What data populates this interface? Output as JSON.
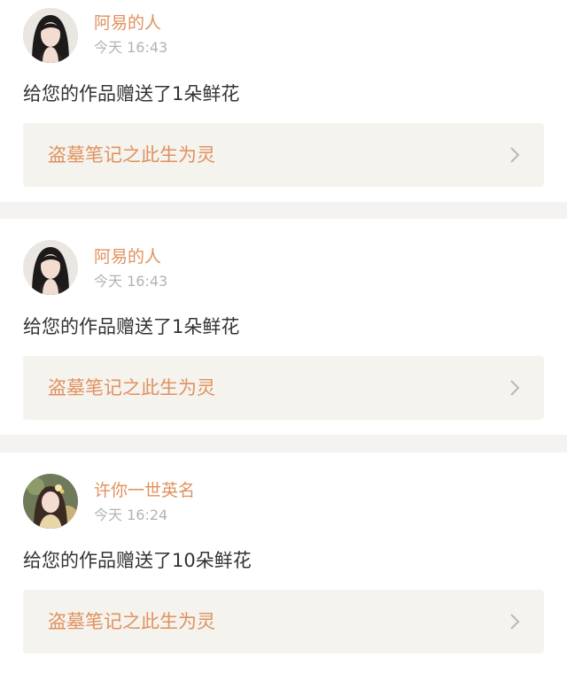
{
  "notifications": [
    {
      "user": "阿易的人",
      "time": "今天 16:43",
      "message": "给您的作品赠送了1朵鲜花",
      "work_title": "盗墓笔记之此生为灵",
      "avatar": "portrait-dark-hair"
    },
    {
      "user": "阿易的人",
      "time": "今天 16:43",
      "message": "给您的作品赠送了1朵鲜花",
      "work_title": "盗墓笔记之此生为灵",
      "avatar": "portrait-dark-hair"
    },
    {
      "user": "许你一世英名",
      "time": "今天 16:24",
      "message": "给您的作品赠送了10朵鲜花",
      "work_title": "盗墓笔记之此生为灵",
      "avatar": "portrait-costume"
    }
  ],
  "colors": {
    "accent": "#e0915f",
    "link_bg": "#f5f3ee",
    "separator": "#f4f3f2",
    "text": "#333333",
    "muted": "#b3b3b3"
  },
  "icons": {
    "chevron": "chevron-right-icon"
  }
}
